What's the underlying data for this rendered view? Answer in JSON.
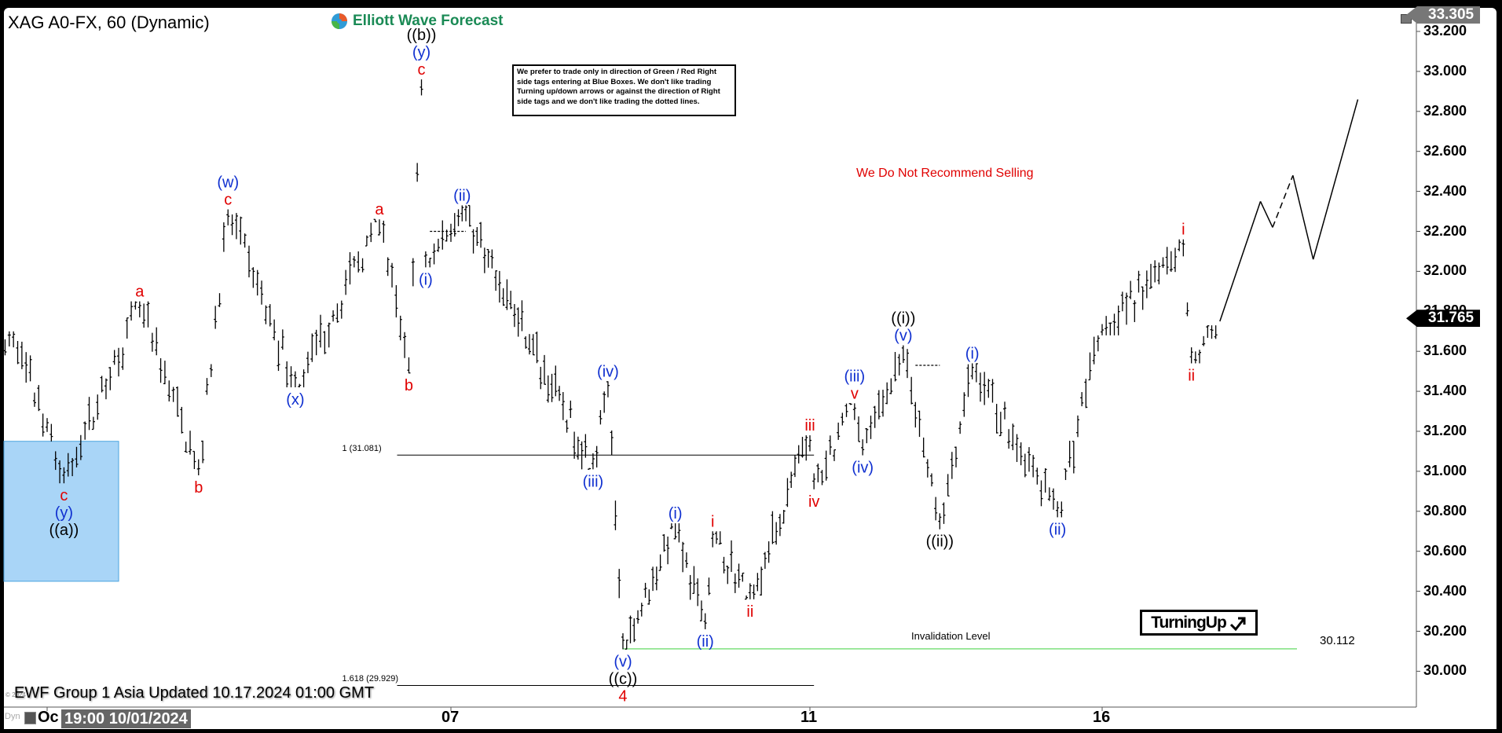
{
  "header": {
    "title": "XAG A0-FX, 60 (Dynamic)",
    "logo_text": "Elliott Wave Forecast"
  },
  "notice": "We prefer to trade only in direction of Green / Red Right side tags entering at Blue Boxes. We don't like trading Turning up/down arrows or against the direction of Right side tags and we don't like trading the dotted lines.",
  "recommendation": "We Do Not Recommend Selling",
  "turning_label": "TurningUp",
  "footer": "EWF Group 1 Asia Updated 10.17.2024 01:00 GMT",
  "copyright": "© 2024",
  "bottom_bar": {
    "dyn": "Dyn",
    "tooltip": "19:00 10/01/2024"
  },
  "price_tags": {
    "high": "33.305",
    "last": "31.765"
  },
  "chart_data": {
    "type": "ohlc-bar",
    "symbol": "XAG A0-FX",
    "timeframe": "60",
    "ylim": [
      29.8,
      33.32
    ],
    "y_ticks": [
      "33.200",
      "33.000",
      "32.800",
      "32.600",
      "32.400",
      "32.200",
      "32.000",
      "31.800",
      "31.600",
      "31.400",
      "31.200",
      "31.000",
      "30.800",
      "30.600",
      "30.400",
      "30.200",
      "30.000"
    ],
    "x_ticks": [
      {
        "label": "Oc",
        "date": "10/01 00:00"
      },
      {
        "label": "07",
        "date": "10/07 00:00"
      },
      {
        "label": "11",
        "date": "10/11 00:00"
      },
      {
        "label": "16",
        "date": "10/16 00:00"
      }
    ],
    "trading_days": [
      "09/30",
      "10/01",
      "10/02",
      "10/03",
      "10/04",
      "10/07",
      "10/08",
      "10/09",
      "10/10",
      "10/11",
      "10/14",
      "10/15",
      "10/16",
      "10/17",
      "10/18"
    ],
    "swings": [
      {
        "t": "09/30 14:00",
        "p": 31.58,
        "kind": "low",
        "labels": []
      },
      {
        "t": "09/30 16:00",
        "p": 31.7,
        "kind": "high",
        "labels": []
      },
      {
        "t": "10/01 04:00",
        "p": 30.94,
        "kind": "low",
        "labels": [
          {
            "text": "c",
            "color": "red"
          },
          {
            "text": "(y)",
            "color": "blue"
          },
          {
            "text": "((a))",
            "color": "black"
          }
        ]
      },
      {
        "t": "10/01 22:00",
        "p": 31.85,
        "kind": "high",
        "labels": [
          {
            "text": "a",
            "color": "red"
          }
        ]
      },
      {
        "t": "10/02 12:00",
        "p": 30.98,
        "kind": "low",
        "labels": [
          {
            "text": "b",
            "color": "red"
          }
        ]
      },
      {
        "t": "10/02 19:00",
        "p": 32.31,
        "kind": "high",
        "labels": [
          {
            "text": "(w)",
            "color": "blue"
          },
          {
            "text": "c",
            "color": "red"
          }
        ]
      },
      {
        "t": "10/03 11:00",
        "p": 31.42,
        "kind": "low",
        "labels": [
          {
            "text": "(x)",
            "color": "blue"
          }
        ]
      },
      {
        "t": "10/04 07:00",
        "p": 32.26,
        "kind": "high",
        "labels": [
          {
            "text": "a",
            "color": "red"
          }
        ]
      },
      {
        "t": "10/04 14:00",
        "p": 31.49,
        "kind": "low",
        "labels": [
          {
            "text": "b",
            "color": "red"
          }
        ]
      },
      {
        "t": "10/04 17:00",
        "p": 32.96,
        "kind": "high",
        "labels": [
          {
            "text": "((b))",
            "color": "black"
          },
          {
            "text": "(y)",
            "color": "blue"
          },
          {
            "text": "c",
            "color": "red"
          }
        ]
      },
      {
        "t": "10/04 18:00",
        "p": 32.02,
        "kind": "low",
        "labels": [
          {
            "text": "(i)",
            "color": "blue"
          }
        ]
      },
      {
        "t": "10/07 03:00",
        "p": 32.33,
        "kind": "high",
        "labels": [
          {
            "text": "(ii)",
            "color": "blue"
          }
        ]
      },
      {
        "t": "10/08 14:00",
        "p": 31.01,
        "kind": "low",
        "labels": [
          {
            "text": "(iii)",
            "color": "blue"
          }
        ]
      },
      {
        "t": "10/08 18:00",
        "p": 31.45,
        "kind": "high",
        "labels": [
          {
            "text": "(iv)",
            "color": "blue"
          }
        ]
      },
      {
        "t": "10/08 22:00",
        "p": 30.11,
        "kind": "low",
        "labels": [
          {
            "text": "(v)",
            "color": "blue"
          },
          {
            "text": "((c))",
            "color": "black"
          },
          {
            "text": "4",
            "color": "red"
          }
        ]
      },
      {
        "t": "10/09 12:00",
        "p": 30.74,
        "kind": "high",
        "labels": [
          {
            "text": "(i)",
            "color": "blue"
          }
        ]
      },
      {
        "t": "10/09 20:00",
        "p": 30.21,
        "kind": "low",
        "labels": [
          {
            "text": "(ii)",
            "color": "blue"
          }
        ]
      },
      {
        "t": "10/09 22:00",
        "p": 30.7,
        "kind": "high",
        "labels": [
          {
            "text": "i",
            "color": "red"
          }
        ]
      },
      {
        "t": "10/10 08:00",
        "p": 30.36,
        "kind": "low",
        "labels": [
          {
            "text": "ii",
            "color": "red"
          }
        ]
      },
      {
        "t": "10/11 00:00",
        "p": 31.18,
        "kind": "high",
        "labels": [
          {
            "text": "iii",
            "color": "red"
          }
        ]
      },
      {
        "t": "10/11 01:00",
        "p": 30.91,
        "kind": "low",
        "labels": [
          {
            "text": "iv",
            "color": "red"
          }
        ]
      },
      {
        "t": "10/11 11:00",
        "p": 31.34,
        "kind": "high",
        "labels": [
          {
            "text": "(iii)",
            "color": "blue"
          },
          {
            "text": "v",
            "color": "red"
          }
        ]
      },
      {
        "t": "10/11 13:00",
        "p": 31.08,
        "kind": "low",
        "labels": [
          {
            "text": "(iv)",
            "color": "blue"
          }
        ]
      },
      {
        "t": "10/11 23:00",
        "p": 31.63,
        "kind": "high",
        "labels": [
          {
            "text": "((i))",
            "color": "black"
          },
          {
            "text": "(v)",
            "color": "blue"
          }
        ]
      },
      {
        "t": "10/14 08:00",
        "p": 30.71,
        "kind": "low",
        "labels": [
          {
            "text": "((ii))",
            "color": "black"
          }
        ]
      },
      {
        "t": "10/14 16:00",
        "p": 31.54,
        "kind": "high",
        "labels": [
          {
            "text": "(i)",
            "color": "blue"
          }
        ]
      },
      {
        "t": "10/15 13:00",
        "p": 30.77,
        "kind": "low",
        "labels": [
          {
            "text": "(ii)",
            "color": "blue"
          }
        ]
      },
      {
        "t": "10/15 23:00",
        "p": 31.68,
        "kind": "high",
        "labels": []
      },
      {
        "t": "10/16 20:00",
        "p": 32.16,
        "kind": "high",
        "labels": [
          {
            "text": "i",
            "color": "red"
          }
        ]
      },
      {
        "t": "10/16 22:00",
        "p": 31.54,
        "kind": "low",
        "labels": [
          {
            "text": "ii",
            "color": "red"
          }
        ]
      },
      {
        "t": "10/17 05:00",
        "p": 31.73,
        "kind": "high",
        "labels": []
      }
    ],
    "projection": [
      {
        "t": "10/17 05:00",
        "p": 31.75,
        "style": "solid"
      },
      {
        "t": "10/17 15:00",
        "p": 32.35,
        "style": "solid"
      },
      {
        "t": "10/17 18:00",
        "p": 32.22,
        "style": "solid"
      },
      {
        "t": "10/17 23:00",
        "p": 32.48,
        "style": "dashed"
      },
      {
        "t": "10/18 04:00",
        "p": 32.06,
        "style": "solid"
      },
      {
        "t": "10/18 15:00",
        "p": 32.86,
        "style": "solid"
      }
    ],
    "dotted_lines": [
      {
        "t1": "10/04 19:00",
        "t2": "10/07 04:00",
        "p": 32.2
      },
      {
        "t1": "10/14 02:00",
        "t2": "10/14 08:00",
        "p": 31.53
      }
    ],
    "fib_levels": [
      {
        "label": "1 (31.081)",
        "p": 31.081,
        "t1": "10/04 00:00",
        "t2": "10/11 01:00"
      },
      {
        "label": "1.618 (29.929)",
        "p": 29.929,
        "t1": "10/04 00:00",
        "t2": "10/11 01:00"
      }
    ],
    "invalidation": {
      "label": "Invalidation Level",
      "value": "30.112",
      "p": 30.112,
      "t1": "10/08 22:00",
      "t2": "10/18 00:00",
      "color": "#7ee07e"
    },
    "blue_box": {
      "p_high": 31.15,
      "p_low": 30.45,
      "t1": "09/30 00:00",
      "t2": "10/01 17:00",
      "color": "#a9d5f7",
      "border": "#4aa3df"
    },
    "colors": {
      "red": "#e00000",
      "blue": "#1030d0",
      "black": "#000000"
    },
    "last_price": 31.765
  }
}
